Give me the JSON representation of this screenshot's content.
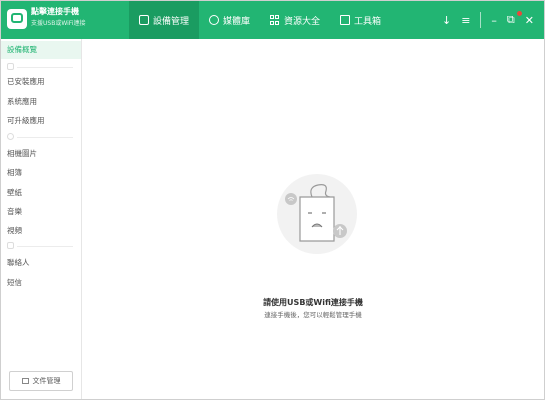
{
  "app": {
    "title": "點擊連接手機",
    "subtitle": "支援USB或WiFi連接",
    "brand_color": "#22b573"
  },
  "nav": {
    "tabs": [
      {
        "label": "設備管理",
        "icon": "phone-icon",
        "active": true
      },
      {
        "label": "媒體庫",
        "icon": "play-circle-icon",
        "active": false
      },
      {
        "label": "資源大全",
        "icon": "grid-icon",
        "active": false
      },
      {
        "label": "工具箱",
        "icon": "toolbox-icon",
        "active": false
      }
    ]
  },
  "window_controls": {
    "download": "↓",
    "menu": "≡",
    "minimize": "–",
    "restore": "⧉",
    "close": "✕"
  },
  "sidebar": {
    "items": [
      {
        "label": "設備概覽",
        "active": true
      },
      {
        "label": "已安裝應用"
      },
      {
        "label": "系統應用"
      },
      {
        "label": "可升級應用"
      },
      {
        "label": "相機圖片"
      },
      {
        "label": "相簿"
      },
      {
        "label": "壁紙"
      },
      {
        "label": "音樂"
      },
      {
        "label": "視頻"
      },
      {
        "label": "聯絡人"
      },
      {
        "label": "短信"
      }
    ],
    "file_button": "文件管理"
  },
  "main": {
    "message_title": "請使用USB或Wifi連接手機",
    "message_sub": "連接手機後，您可以輕鬆管理手機"
  }
}
